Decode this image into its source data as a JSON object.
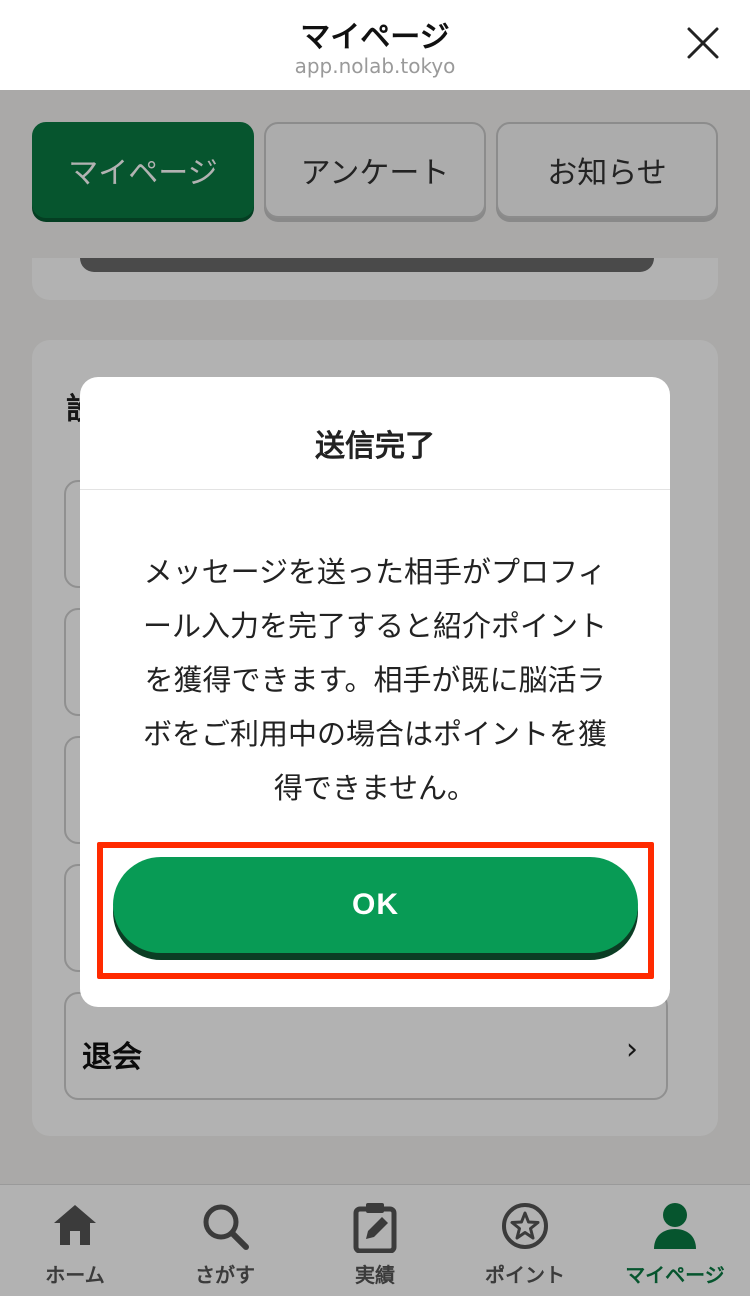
{
  "header": {
    "title": "マイページ",
    "url": "app.nolab.tokyo"
  },
  "tabs": [
    {
      "label": "マイページ",
      "active": true
    },
    {
      "label": "アンケート",
      "active": false
    },
    {
      "label": "お知らせ",
      "active": false
    }
  ],
  "settings": {
    "section_title": "設",
    "withdraw_label": "退会"
  },
  "modal": {
    "title": "送信完了",
    "message_lines": [
      "メッセージを送った相手がプロフィ",
      "ール入力を完了すると紹介ポイント",
      "を獲得できます。相手が既に脳活ラ",
      "ボをご利用中の場合はポイントを獲",
      "得できません。"
    ],
    "ok_label": "OK"
  },
  "bottom_nav": [
    {
      "label": "ホーム",
      "icon": "home-icon"
    },
    {
      "label": "さがす",
      "icon": "search-icon"
    },
    {
      "label": "実績",
      "icon": "clipboard-icon"
    },
    {
      "label": "ポイント",
      "icon": "star-icon"
    },
    {
      "label": "マイページ",
      "icon": "person-icon",
      "active": true
    }
  ],
  "colors": {
    "brand_green": "#0a7a43",
    "button_green": "#089b55",
    "highlight_red": "#ff2a00"
  }
}
